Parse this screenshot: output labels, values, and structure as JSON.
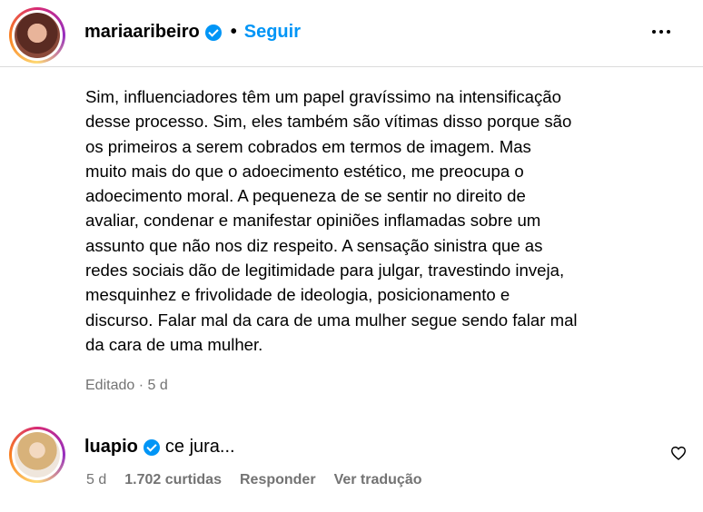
{
  "post": {
    "author": "mariaaribeiro",
    "dot": "•",
    "follow_label": "Seguir",
    "caption_lines": [
      "Sim, influenciadores têm um papel gravíssimo na intensificação",
      "desse processo. Sim, eles também são vítimas disso porque são",
      "os primeiros a serem cobrados em termos de imagem. Mas",
      "muito mais do que o adoecimento estético, me preocupa o",
      "adoecimento moral. A pequeneza de se sentir no direito de",
      "avaliar, condenar e manifestar opiniões inflamadas sobre um",
      "assunto que não nos diz respeito. A sensação sinistra que as",
      "redes sociais dão de legitimidade para julgar, travestindo inveja,",
      "mesquinhez e frivolidade de ideologia, posicionamento e",
      "discurso. Falar mal da cara de uma mulher segue sendo falar mal",
      "da cara de uma mulher."
    ],
    "meta": "Editado · 5 d"
  },
  "comment": {
    "author": "luapio",
    "text": "ce jura...",
    "time": "5 d",
    "likes": "1.702 curtidas",
    "reply_label": "Responder",
    "translate_label": "Ver tradução"
  },
  "colors": {
    "accent": "#0095f6",
    "secondary_text": "#737373",
    "divider": "#dbdbdb"
  },
  "icons": [
    "verified-badge-icon",
    "more-options-icon",
    "heart-icon"
  ]
}
